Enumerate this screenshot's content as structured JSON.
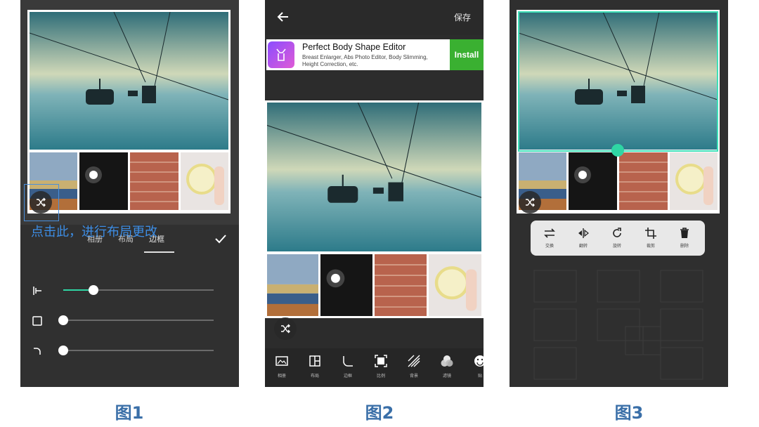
{
  "panels": [
    {
      "caption": "图1",
      "tabs": [
        "相册",
        "布局",
        "边框"
      ],
      "active_tab": "边框",
      "hint": "点击此，进行布局更改",
      "sliders": [
        {
          "icon": "border-width-icon",
          "value": 0.2
        },
        {
          "icon": "square-icon",
          "value": 0.0
        },
        {
          "icon": "corner-radius-icon",
          "value": 0.0
        }
      ]
    },
    {
      "caption": "图2",
      "save_label": "保存",
      "ad": {
        "title": "Perfect Body Shape Editor",
        "description": "Breast Enlarger, Abs Photo Editor, Body Slimming, Height Correction, etc.",
        "install": "Install"
      },
      "tools": [
        "相册",
        "布局",
        "边框",
        "比例",
        "背景",
        "滤镜",
        "贴"
      ]
    },
    {
      "caption": "图3",
      "actions": [
        "交换",
        "翻转",
        "旋转",
        "裁剪",
        "删除"
      ]
    }
  ],
  "colors": {
    "accent": "#2fd6a4",
    "caption": "#3a6fa8",
    "hint": "#3d8ee6",
    "install": "#3ab031"
  }
}
